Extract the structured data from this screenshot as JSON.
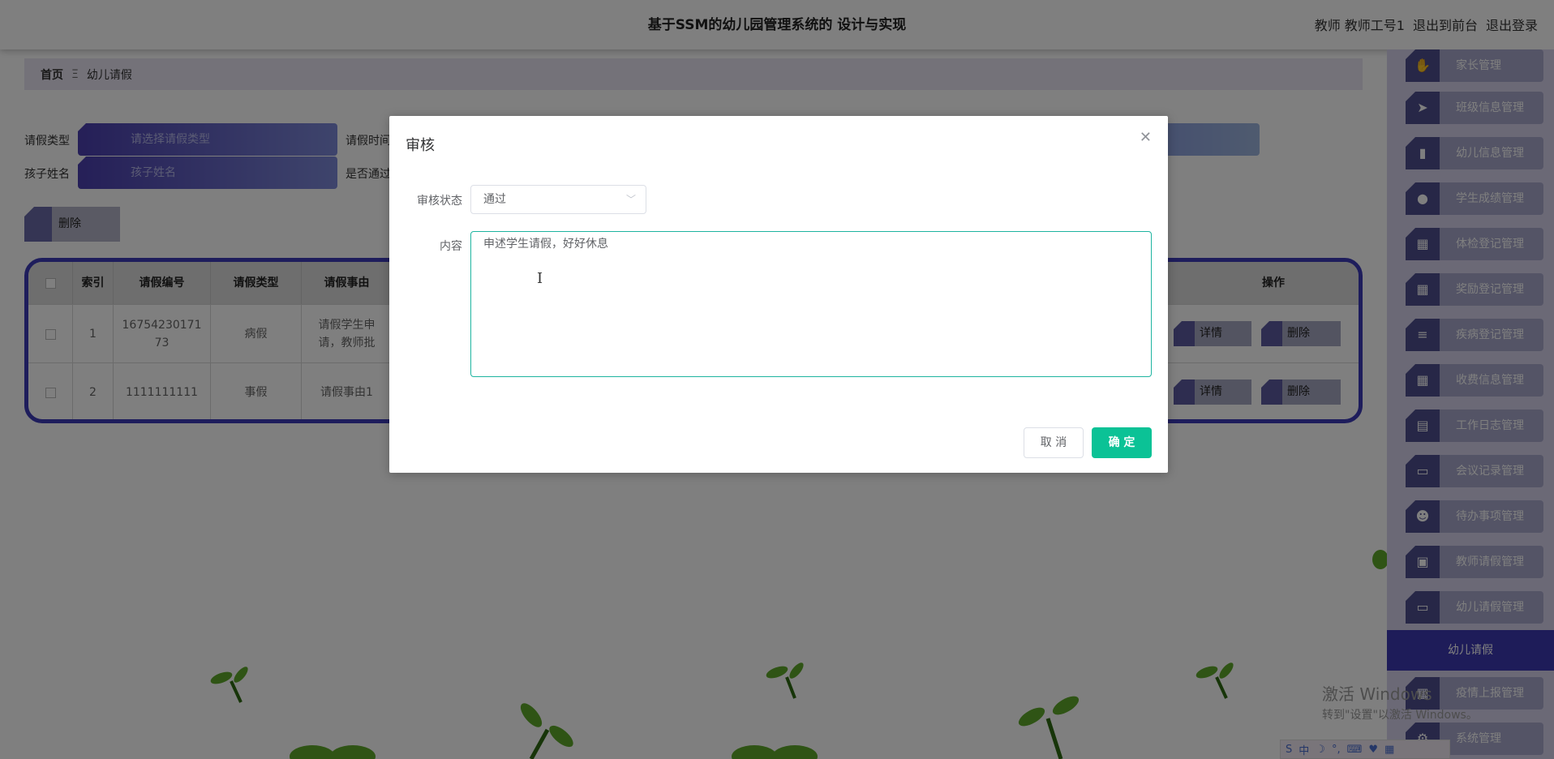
{
  "header": {
    "title": "基于SSM的幼儿园管理系统的 设计与实现",
    "user_label": "教师 教师工号1",
    "front_link": "退出到前台",
    "logout_link": "退出登录"
  },
  "breadcrumb": {
    "home": "首页",
    "sep": "Ξ",
    "current": "幼儿请假"
  },
  "search": {
    "type_label": "请假类型",
    "type_placeholder": "请选择请假类型",
    "time_label": "请假时间",
    "child_label": "孩子姓名",
    "child_placeholder": "孩子姓名",
    "pass_label": "是否通过"
  },
  "toolbar": {
    "delete_label": "删除"
  },
  "table": {
    "headers": [
      "索引",
      "请假编号",
      "请假类型",
      "请假事由",
      "操作"
    ],
    "rows": [
      {
        "index": "1",
        "id": "1675423017173",
        "type": "病假",
        "reason": "请假学生申请，教师批"
      },
      {
        "index": "2",
        "id": "1111111111",
        "type": "事假",
        "reason": "请假事由1"
      }
    ],
    "detail_label": "详情",
    "delete_label": "删除"
  },
  "sidebar": {
    "items": [
      {
        "label": "家长管理",
        "icon": "thumb-icon"
      },
      {
        "label": "班级信息管理",
        "icon": "paper-plane-icon"
      },
      {
        "label": "幼儿信息管理",
        "icon": "bar-chart-icon"
      },
      {
        "label": "学生成绩管理",
        "icon": "bulb-icon"
      },
      {
        "label": "体检登记管理",
        "icon": "grid-icon"
      },
      {
        "label": "奖励登记管理",
        "icon": "grid-icon"
      },
      {
        "label": "疾病登记管理",
        "icon": "list-icon"
      },
      {
        "label": "收费信息管理",
        "icon": "grid-icon"
      },
      {
        "label": "工作日志管理",
        "icon": "table-icon"
      },
      {
        "label": "会议记录管理",
        "icon": "monitor-icon"
      },
      {
        "label": "待办事项管理",
        "icon": "user-icon"
      },
      {
        "label": "教师请假管理",
        "icon": "doc-icon"
      },
      {
        "label": "幼儿请假管理",
        "icon": "monitor-icon"
      }
    ],
    "active": "幼儿请假",
    "after_items": [
      {
        "label": "疫情上报管理",
        "icon": "grid-icon"
      },
      {
        "label": "系统管理",
        "icon": "gear-icon"
      }
    ]
  },
  "watermark": {
    "line1": "激活 Windows",
    "line2": "转到\"设置\"以激活 Windows。"
  },
  "modal": {
    "title": "审核",
    "status_label": "审核状态",
    "status_value": "通过",
    "content_label": "内容",
    "content_value": "申述学生请假，好好休息",
    "cancel_label": "取 消",
    "ok_label": "确 定"
  }
}
